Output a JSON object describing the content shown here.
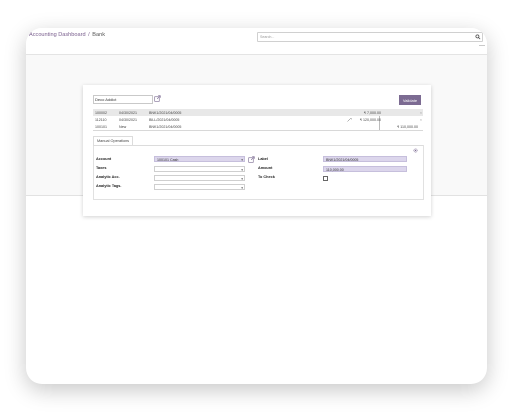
{
  "header": {
    "breadcrumb": [
      {
        "label": "Accounting Dashboard",
        "link": true
      },
      {
        "separator": "/"
      },
      {
        "label": "Bank",
        "link": false
      }
    ],
    "search": {
      "placeholder": "Search..."
    }
  },
  "reconcile": {
    "partner": {
      "value": "Deco Addict"
    },
    "validate_label": "Validate",
    "lines": [
      {
        "code": "100002",
        "date": "04/30/2021",
        "label": "BNK1/2021/04/0005",
        "debit": "",
        "credit": "₹ 7,000.00",
        "remove": "×"
      },
      {
        "code": "112110",
        "date": "04/30/2021",
        "label": "BILL/2021/04/0005",
        "debit": "₹ 120,000.00",
        "credit": "",
        "remove": "×"
      },
      {
        "code": "100101",
        "date": "New",
        "label": "BNK1/2021/04/0005",
        "debit": "",
        "credit": "₹ 110,000.00",
        "remove": ""
      }
    ],
    "tab_label": "Manual Operations",
    "form": {
      "account_label": "Account",
      "account_value": "100101 Cash",
      "taxes_label": "Taxes",
      "taxes_value": "",
      "analytic_acc_label": "Analytic Acc.",
      "analytic_acc_value": "",
      "analytic_tags_label": "Analytic Tags.",
      "analytic_tags_value": "",
      "label_label": "Label",
      "label_value": "BNK1/2021/04/0005",
      "amount_label": "Amount",
      "amount_value": "110,000.00",
      "to_check_label": "To Check",
      "to_check_value": false
    }
  },
  "colors": {
    "accent": "#7c6b92",
    "breadcrumb_link": "#7a5f8e",
    "highlight_field": "#dcd6ec",
    "selected_row": "#e8e8e8"
  },
  "icons": [
    "search-icon",
    "external-link-icon",
    "edit-icon",
    "gear-icon",
    "dropdown-caret-icon"
  ]
}
